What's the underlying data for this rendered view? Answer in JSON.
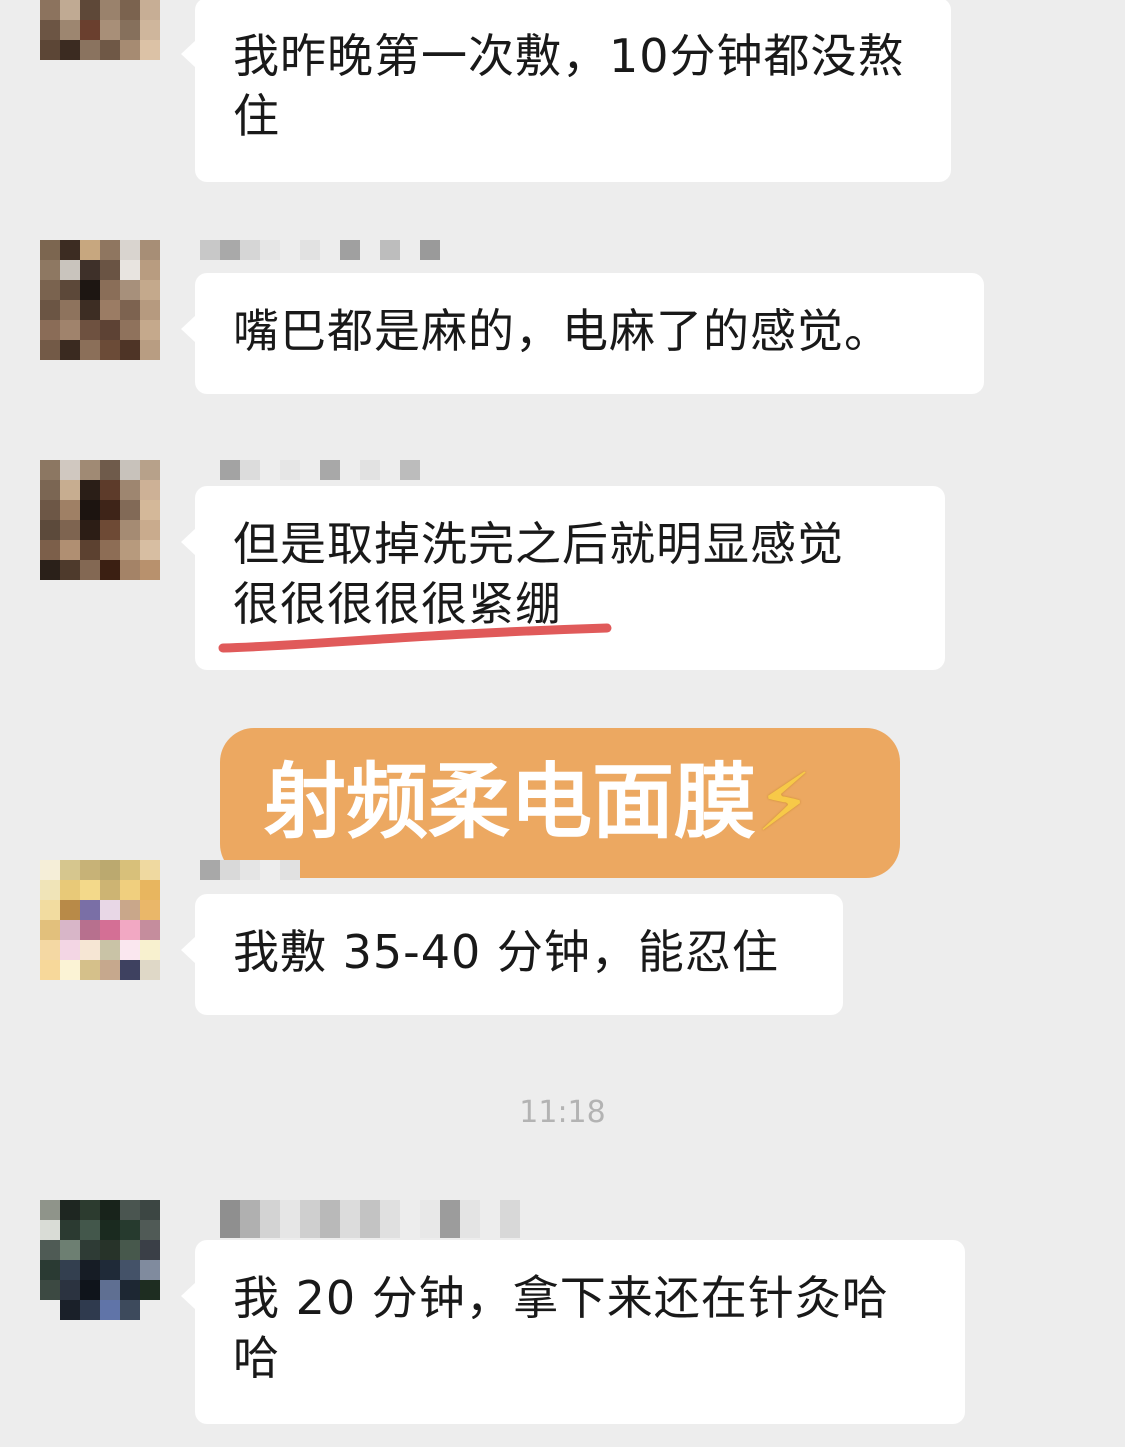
{
  "messages": [
    {
      "text": "我昨晚第一次敷，10分钟都没熬住"
    },
    {
      "text": "嘴巴都是麻的，电麻了的感觉。"
    },
    {
      "text_line1": "但是取掉洗完之后就明显感觉",
      "text_line2": "很很很很很紧绷"
    },
    {
      "text": "我敷 35-40 分钟，能忍住"
    },
    {
      "text": "我 20 分钟，拿下来还在针灸哈哈"
    }
  ],
  "timestamps": {
    "t1": "11:18"
  },
  "overlay": {
    "label": "射频柔电面膜",
    "icon": "lightning-icon"
  },
  "colors": {
    "background": "#ededed",
    "bubble": "#ffffff",
    "overlay": "#eca861",
    "underline": "#e05a5a"
  }
}
